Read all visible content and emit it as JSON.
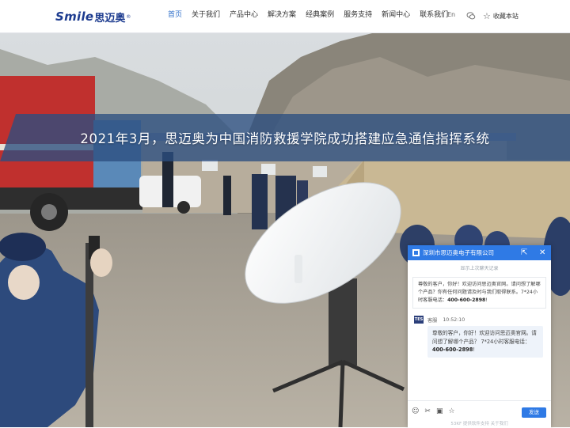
{
  "logo": {
    "brand": "Smile",
    "chinese": "思迈奥",
    "mark": "®"
  },
  "nav": {
    "items": [
      {
        "label": "首页",
        "active": true
      },
      {
        "label": "关于我们"
      },
      {
        "label": "产品中心"
      },
      {
        "label": "解决方案"
      },
      {
        "label": "经典案例"
      },
      {
        "label": "服务支持"
      },
      {
        "label": "新闻中心"
      },
      {
        "label": "联系我们"
      }
    ],
    "language": "En",
    "favorite": "收藏本站"
  },
  "hero": {
    "title": "2021年3月，思迈奥为中国消防救援学院成功搭建应急通信指挥系统"
  },
  "chat": {
    "company": "深圳市思迈奥电子有限公司",
    "history_label": "显示上次聊天记录",
    "history_message": "尊敬的客户，你好！欢迎访问思迈奥官网。请问想了解哪个产品？你有任何问题请及时与我们取得联系。7*24小时客服电话：",
    "phone": "400-600-2898",
    "agent_name": "客服",
    "time": "10:52:10",
    "agent_avatar_text": "TES",
    "agent_message": "尊敬的客户，你好！欢迎访问思迈奥官网。请问想了解哪个产品？ 7*24小时客服电话：",
    "send_label": "发送",
    "powered_by": "53KF 提供软件支持   关于我们",
    "tools": [
      "smiley-icon",
      "scissors-icon",
      "folder-icon",
      "star-icon"
    ]
  },
  "colors": {
    "accent": "#2f7ae5",
    "brand": "#1c3b8f",
    "nav_active": "#2f6fc9"
  }
}
